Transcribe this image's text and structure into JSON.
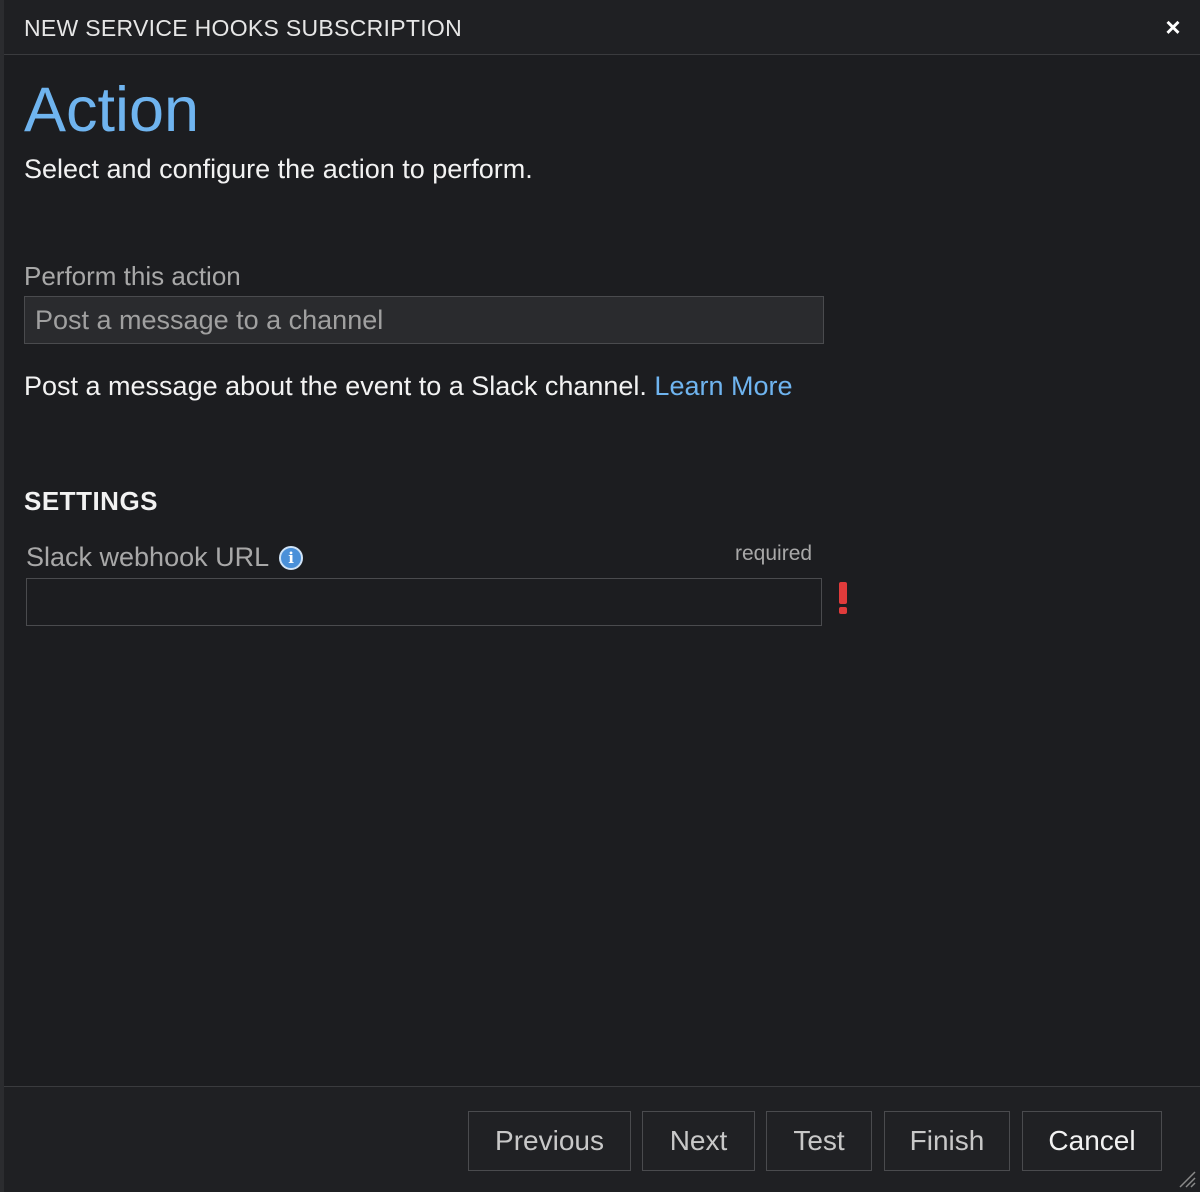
{
  "dialog": {
    "title": "NEW SERVICE HOOKS SUBSCRIPTION",
    "close_glyph": "×"
  },
  "page": {
    "heading": "Action",
    "subheading": "Select and configure the action to perform."
  },
  "action": {
    "label": "Perform this action",
    "selected_value": "Post a message to a channel",
    "description": "Post a message about the event to a Slack channel.",
    "learn_more_label": "Learn More"
  },
  "settings": {
    "header": "SETTINGS",
    "webhook_label": "Slack webhook URL",
    "info_glyph": "i",
    "required_tag": "required",
    "webhook_value": ""
  },
  "footer": {
    "previous_label": "Previous",
    "next_label": "Next",
    "test_label": "Test",
    "finish_label": "Finish",
    "cancel_label": "Cancel"
  },
  "colors": {
    "accent": "#6fb4ef",
    "background": "#1c1d20",
    "error": "#e03b3b"
  }
}
